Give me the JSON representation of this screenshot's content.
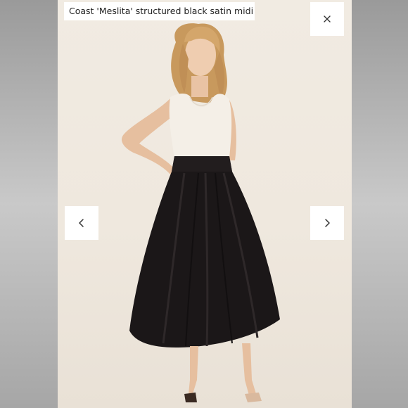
{
  "viewer": {
    "caption": "Coast 'Meslita' structured black satin midi skirt",
    "close_icon": "close-icon",
    "prev_icon": "chevron-left-icon",
    "next_icon": "chevron-right-icon"
  },
  "colors": {
    "backdrop": "#b5b5b5",
    "photo_background": "#efe8de",
    "skirt": "#1b1718",
    "top": "#f3eee6",
    "control_background": "#ffffff"
  }
}
